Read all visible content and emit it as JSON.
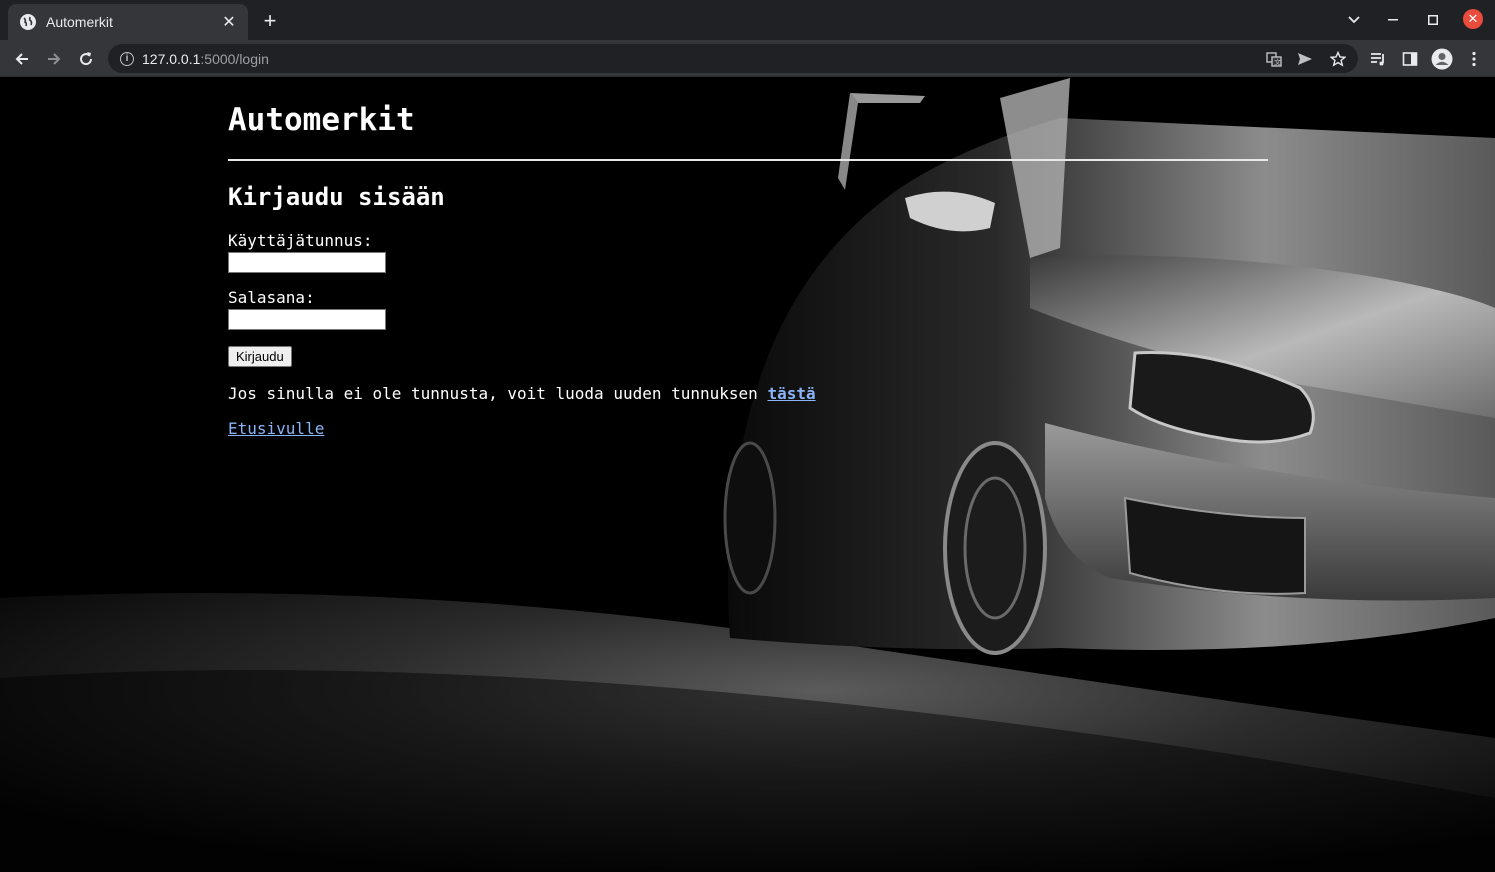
{
  "browser": {
    "tab_title": "Automerkit",
    "url_host": "127.0.0.1",
    "url_path": ":5000/login",
    "icons": [
      "back-icon",
      "forward-icon",
      "reload-icon",
      "info-icon",
      "translate-icon",
      "send-icon",
      "star-icon",
      "media-icon",
      "sidepanel-icon",
      "profile-icon",
      "menu-icon"
    ]
  },
  "page": {
    "site_title": "Automerkit",
    "section_title": "Kirjaudu sisään",
    "username_label": "Käyttäjätunnus:",
    "password_label": "Salasana:",
    "submit_label": "Kirjaudu",
    "register_text": "Jos sinulla ei ole tunnusta, voit luoda uuden tunnuksen ",
    "register_link": "tästä",
    "home_link": "Etusivulle"
  }
}
